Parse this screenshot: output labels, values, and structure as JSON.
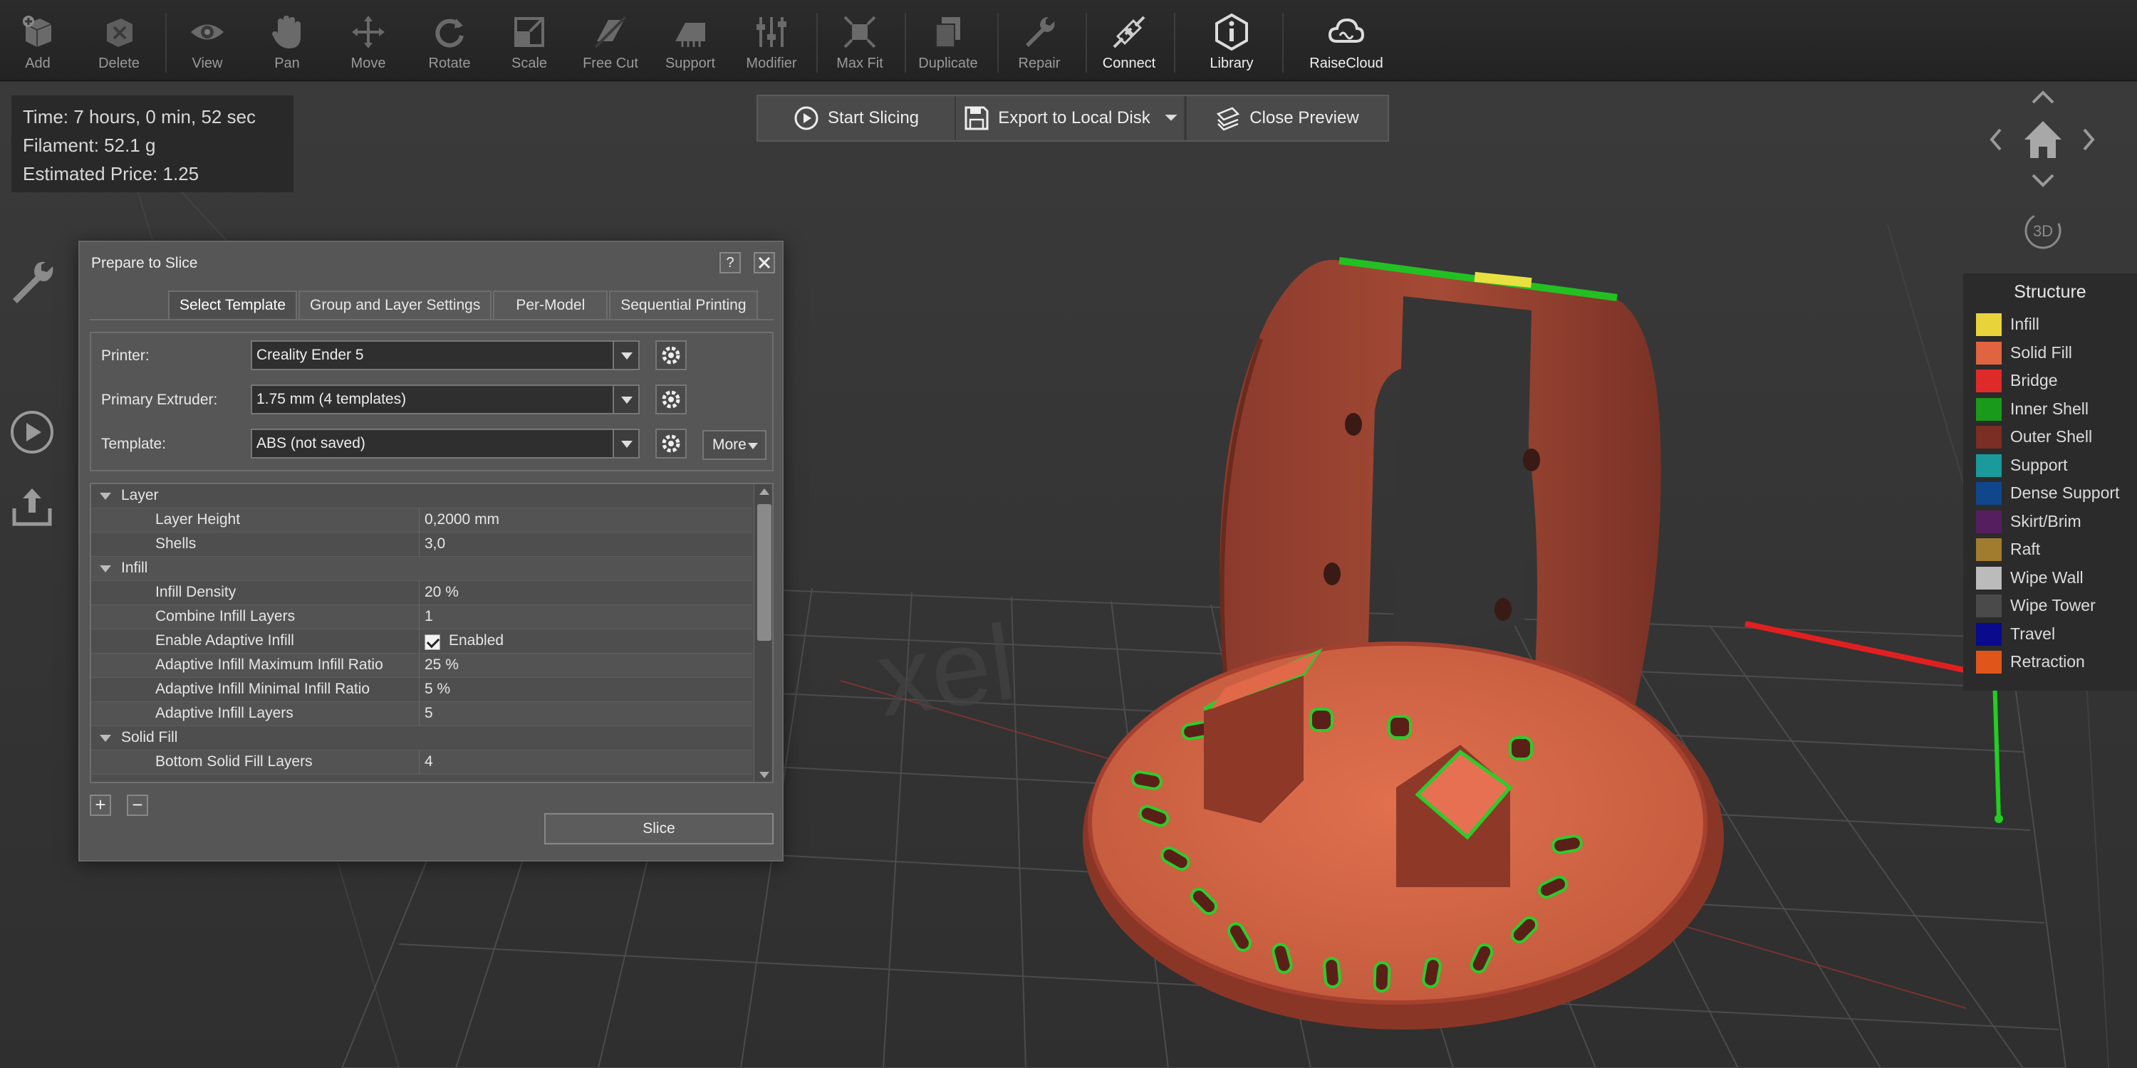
{
  "toolbar": {
    "items": [
      {
        "label": "Add",
        "icon": "add-icon"
      },
      {
        "label": "Delete",
        "icon": "delete-icon"
      },
      {
        "label": "View",
        "icon": "eye-icon"
      },
      {
        "label": "Pan",
        "icon": "hand-icon"
      },
      {
        "label": "Move",
        "icon": "move-icon"
      },
      {
        "label": "Rotate",
        "icon": "rotate-icon"
      },
      {
        "label": "Scale",
        "icon": "scale-icon"
      },
      {
        "label": "Free Cut",
        "icon": "cut-icon"
      },
      {
        "label": "Support",
        "icon": "support-icon"
      },
      {
        "label": "Modifier",
        "icon": "modifier-icon"
      },
      {
        "label": "Max Fit",
        "icon": "maxfit-icon"
      },
      {
        "label": "Duplicate",
        "icon": "duplicate-icon"
      },
      {
        "label": "Repair",
        "icon": "wrench-icon"
      },
      {
        "label": "Connect",
        "icon": "connect-icon"
      },
      {
        "label": "Library",
        "icon": "library-icon"
      },
      {
        "label": "RaiseCloud",
        "icon": "cloud-icon"
      }
    ]
  },
  "info": {
    "time": "Time: 7 hours, 0 min, 52 sec",
    "filament": "Filament: 52.1 g",
    "price": "Estimated Price: 1.25"
  },
  "slicebar": {
    "start": "Start Slicing",
    "export": "Export to Local Disk",
    "close": "Close Preview"
  },
  "nav": {
    "mode": "3D"
  },
  "dialog": {
    "title": "Prepare to Slice",
    "help": "?",
    "tabs": [
      "Select Template",
      "Group and Layer Settings",
      "Per-Model",
      "Sequential Printing"
    ],
    "printer_label": "Printer:",
    "printer_value": "Creality Ender 5",
    "extruder_label": "Primary Extruder:",
    "extruder_value": "1.75 mm (4 templates)",
    "template_label": "Template:",
    "template_value": "ABS (not saved)",
    "more": "More",
    "rows": [
      {
        "type": "section",
        "name": "Layer",
        "value": ""
      },
      {
        "type": "item",
        "name": "Layer Height",
        "value": "0,2000 mm"
      },
      {
        "type": "item",
        "name": "Shells",
        "value": "3,0"
      },
      {
        "type": "section",
        "name": "Infill",
        "value": ""
      },
      {
        "type": "item",
        "name": "Infill Density",
        "value": "20 %"
      },
      {
        "type": "item",
        "name": "Combine Infill Layers",
        "value": "1"
      },
      {
        "type": "check",
        "name": "Enable Adaptive Infill",
        "value": "Enabled"
      },
      {
        "type": "item",
        "name": "Adaptive Infill Maximum Infill Ratio",
        "value": "25 %"
      },
      {
        "type": "item",
        "name": "Adaptive Infill Minimal Infill Ratio",
        "value": "5 %"
      },
      {
        "type": "item",
        "name": "Adaptive Infill Layers",
        "value": "5"
      },
      {
        "type": "section",
        "name": "Solid Fill",
        "value": ""
      },
      {
        "type": "item",
        "name": "Bottom Solid Fill Layers",
        "value": "4"
      }
    ],
    "plus": "+",
    "minus": "−",
    "slice": "Slice"
  },
  "legend": {
    "title": "Structure",
    "items": [
      {
        "label": "Infill",
        "color": "#e8d43a"
      },
      {
        "label": "Solid Fill",
        "color": "#e0643f"
      },
      {
        "label": "Bridge",
        "color": "#e02a2a"
      },
      {
        "label": "Inner Shell",
        "color": "#1a9a1a"
      },
      {
        "label": "Outer Shell",
        "color": "#7a2e24"
      },
      {
        "label": "Support",
        "color": "#1a9a9a"
      },
      {
        "label": "Dense Support",
        "color": "#10468c"
      },
      {
        "label": "Skirt/Brim",
        "color": "#551e5e"
      },
      {
        "label": "Raft",
        "color": "#a07c2e"
      },
      {
        "label": "Wipe Wall",
        "color": "#bbbbbb"
      },
      {
        "label": "Wipe Tower",
        "color": "#4a4a4a"
      },
      {
        "label": "Travel",
        "color": "#0a0a8c"
      },
      {
        "label": "Retraction",
        "color": "#e0561a"
      }
    ]
  }
}
